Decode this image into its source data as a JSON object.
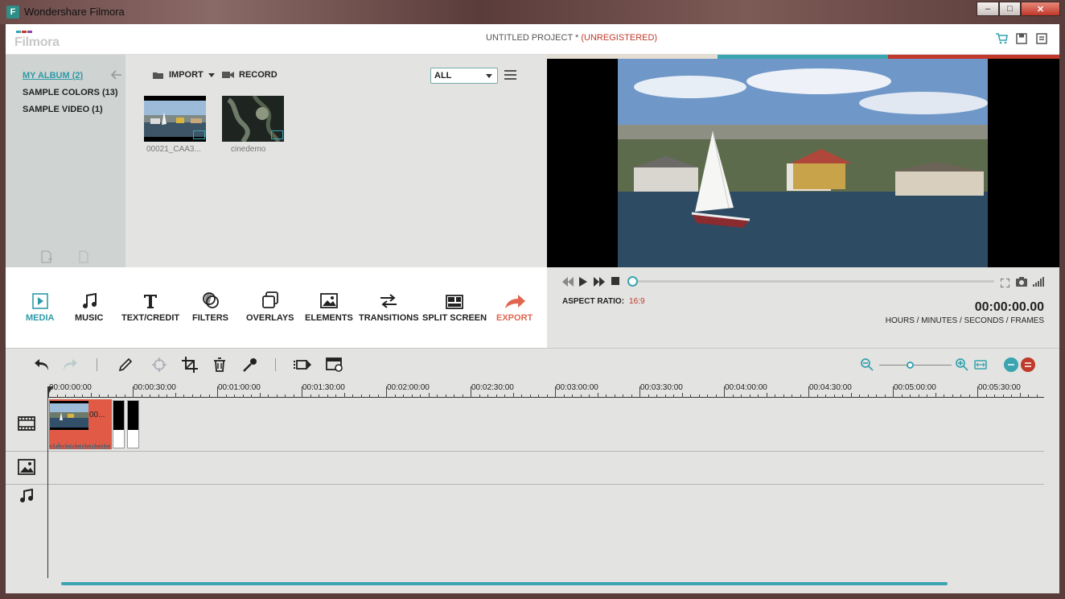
{
  "window": {
    "title": "Wondershare Filmora",
    "icon_letter": "F",
    "minimize_glyph": "–",
    "maximize_glyph": "□",
    "close_glyph": "✕"
  },
  "header": {
    "logo": "Filmora",
    "logo_colors": [
      "#3aa4b0",
      "#c0392b",
      "#8e44ad"
    ],
    "project_name": "UNTITLED PROJECT *",
    "project_status": "(UNREGISTERED)",
    "icons": [
      "cart-icon",
      "save-icon",
      "menu-icon"
    ]
  },
  "album": {
    "items": [
      {
        "label": "MY ALBUM (2)",
        "active": true
      },
      {
        "label": "SAMPLE COLORS (13)",
        "active": false
      },
      {
        "label": "SAMPLE VIDEO (1)",
        "active": false
      }
    ]
  },
  "library": {
    "import_label": "IMPORT",
    "record_label": "RECORD",
    "filter_value": "ALL",
    "items": [
      {
        "label": "00021_CAA3..."
      },
      {
        "label": "cinedemo"
      }
    ]
  },
  "preview": {
    "bar_colors": [
      "#e3ddd2",
      "#3aa4b0",
      "#c0392b"
    ],
    "aspect_label": "ASPECT RATIO:",
    "aspect_value": "16:9",
    "timecode": "00:00:00.00",
    "timecode_units": "HOURS / MINUTES / SECONDS / FRAMES"
  },
  "modes": [
    {
      "label": "MEDIA",
      "icon": "media-icon",
      "active": true
    },
    {
      "label": "MUSIC",
      "icon": "music-icon"
    },
    {
      "label": "TEXT/CREDIT",
      "icon": "text-icon"
    },
    {
      "label": "FILTERS",
      "icon": "filters-icon"
    },
    {
      "label": "OVERLAYS",
      "icon": "overlays-icon"
    },
    {
      "label": "ELEMENTS",
      "icon": "elements-icon"
    },
    {
      "label": "TRANSITIONS",
      "icon": "transitions-icon"
    },
    {
      "label": "SPLIT SCREEN",
      "icon": "split-screen-icon"
    },
    {
      "label": "EXPORT",
      "icon": "export-icon"
    }
  ],
  "timeline": {
    "ticks": [
      "00:00:00:00",
      "00:00:30:00",
      "00:01:00:00",
      "00:01:30:00",
      "00:02:00:00",
      "00:02:30:00",
      "00:03:00:00",
      "00:03:30:00",
      "00:04:00:00",
      "00:04:30:00",
      "00:05:00:00",
      "00:05:30:00"
    ],
    "clip_label": "00..."
  }
}
